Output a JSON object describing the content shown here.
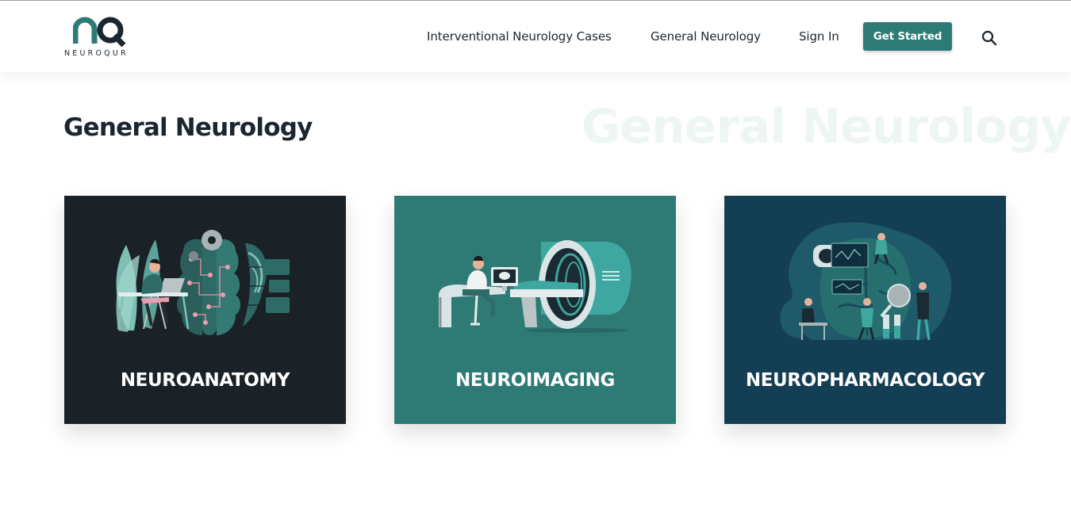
{
  "header": {
    "logo_text": "NEUROQUR",
    "nav": [
      {
        "label": "Interventional Neurology Cases"
      },
      {
        "label": "General Neurology"
      },
      {
        "label": "Sign In"
      }
    ],
    "cta_label": "Get Started",
    "search_icon": "search-icon"
  },
  "main": {
    "title": "General Neurology",
    "watermark": "General Neurology",
    "cards": [
      {
        "label": "NEUROANATOMY",
        "bg": "#1a2228"
      },
      {
        "label": "NEUROIMAGING",
        "bg": "#2e7a75"
      },
      {
        "label": "NEUROPHARMACOLOGY",
        "bg": "#143e54"
      }
    ]
  },
  "colors": {
    "brand": "#2e7a75",
    "text": "#1b2630",
    "card_dark": "#1a2228",
    "card_teal": "#2e7a75",
    "card_navy": "#143e54"
  }
}
